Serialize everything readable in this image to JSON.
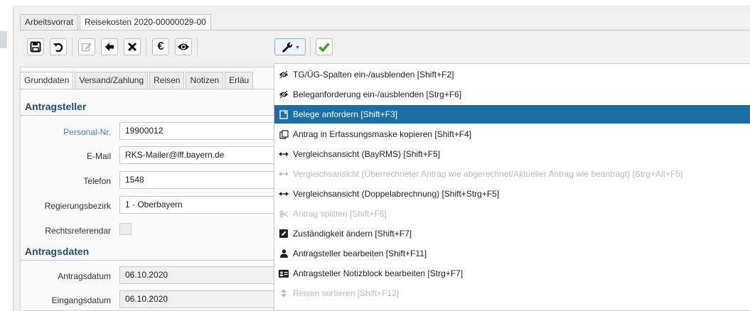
{
  "doc_tabs": [
    "Arbeitsvorrat",
    "Reisekosten 2020-00000029-00"
  ],
  "sub_tabs": [
    "Grunddaten",
    "Versand/Zahlung",
    "Reisen",
    "Notizen",
    "Erläu"
  ],
  "sections": {
    "antragsteller": "Antragsteller",
    "antragsdaten": "Antragsdaten"
  },
  "fields": {
    "personal_nr": {
      "label": "Personal-Nr.",
      "value": "19900012"
    },
    "email": {
      "label": "E-Mail",
      "value": "RKS-Mailer@lff.bayern.de"
    },
    "telefon": {
      "label": "Telefon",
      "value": "1548"
    },
    "regierungsbezirk": {
      "label": "Regierungsbezirk",
      "value": "1 - Oberbayern"
    },
    "rechtsreferendar": {
      "label": "Rechtsreferendar",
      "checked": false
    },
    "antragsdatum": {
      "label": "Antragsdatum",
      "value": "06.10.2020"
    },
    "eingangsdatum": {
      "label": "Eingangsdatum",
      "value": "06.10.2020"
    }
  },
  "toolbar_icons": [
    "save-icon",
    "undo-icon",
    "edit-icon",
    "back-arrow-icon",
    "cancel-icon",
    "euro-icon",
    "eye-icon",
    "wrench-icon",
    "check-icon"
  ],
  "menu": {
    "items": [
      {
        "label": "TG/ÜG-Spalten ein-/ausblenden [Shift+F2]",
        "icon": "eye-slash-icon",
        "enabled": true,
        "selected": false
      },
      {
        "label": "Beleganforderung ein-/ausblenden [Strg+F6]",
        "icon": "eye-slash-icon",
        "enabled": true,
        "selected": false
      },
      {
        "label": "Belege anfordern [Shift+F3]",
        "icon": "document-icon",
        "enabled": true,
        "selected": true
      },
      {
        "label": "Antrag in Erfassungsmaske kopieren [Shift+F4]",
        "icon": "copy-icon",
        "enabled": true,
        "selected": false
      },
      {
        "label": "Vergleichsansicht (BayRMS) [Shift+F5]",
        "icon": "arrows-horizontal-icon",
        "enabled": true,
        "selected": false
      },
      {
        "label": "Vergleichsansicht (Überrechneter Antrag wie abgerechnet/Aktueller Antrag wie beantragt) [Strg+Alt+F5]",
        "icon": "arrows-horizontal-icon",
        "enabled": false,
        "selected": false
      },
      {
        "label": "Vergleichsansicht (Doppelabrechnung) [Shift+Strg+F5]",
        "icon": "arrows-horizontal-icon",
        "enabled": true,
        "selected": false
      },
      {
        "label": "Antrag splitten [Shift+F6]",
        "icon": "scissors-icon",
        "enabled": false,
        "selected": false
      },
      {
        "label": "Zuständigkeit ändern [Shift+F7]",
        "icon": "edit-square-icon",
        "enabled": true,
        "selected": false
      },
      {
        "label": "Antragsteller bearbeiten [Shift+F11]",
        "icon": "user-icon",
        "enabled": true,
        "selected": false
      },
      {
        "label": "Antragsteller Notizblock bearbeiten [Strg+F7]",
        "icon": "id-card-icon",
        "enabled": true,
        "selected": false
      },
      {
        "label": "Reisen sortieren [Shift+F12]",
        "icon": "sort-icon",
        "enabled": false,
        "selected": false
      }
    ]
  },
  "colors": {
    "accent": "#1a6fa6",
    "section_title": "#1f4e79",
    "link_label": "#4a7fb5",
    "check_green": "#3a9a2a"
  }
}
